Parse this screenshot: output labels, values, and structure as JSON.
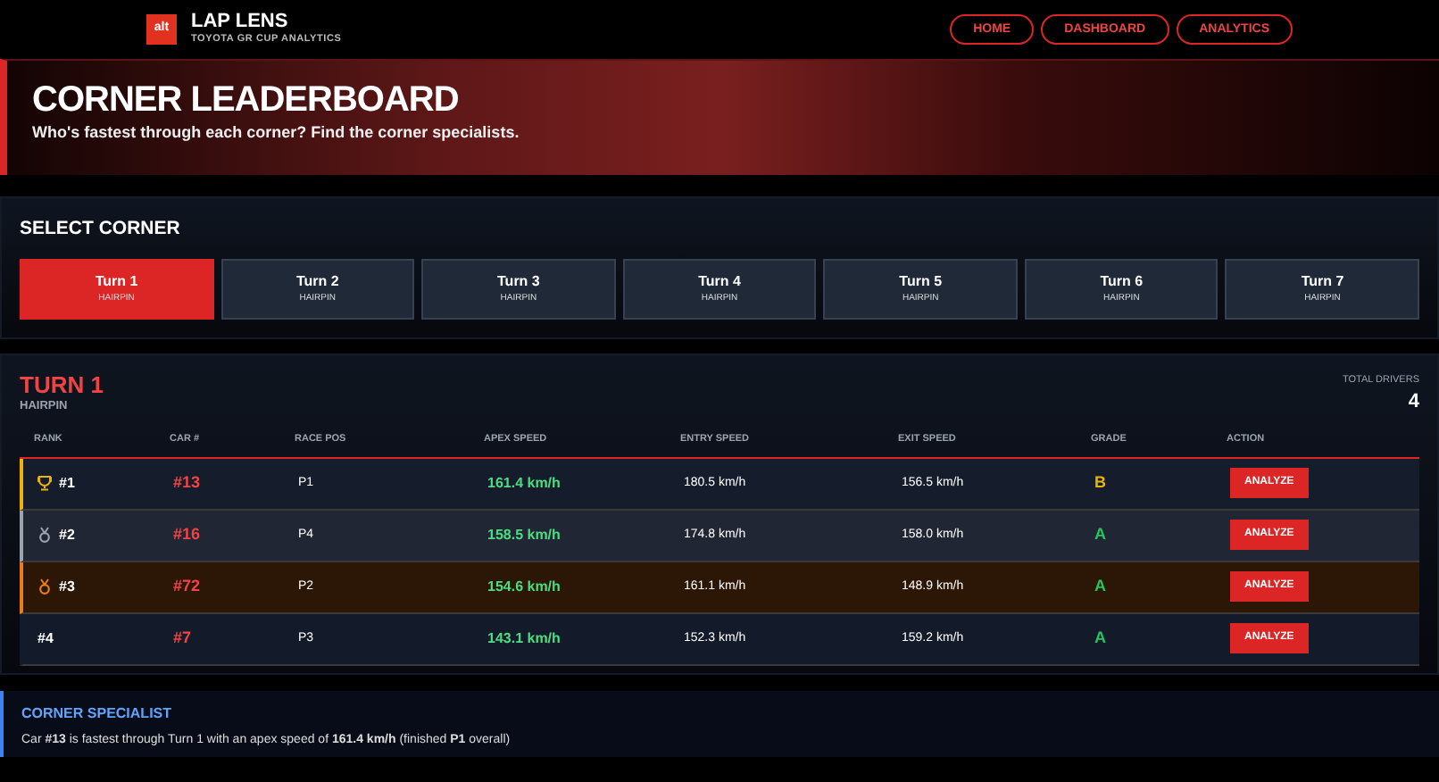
{
  "brand": {
    "logo": "alt",
    "title": "LAP LENS",
    "subtitle": "TOYOTA GR CUP ANALYTICS"
  },
  "nav": [
    {
      "label": "HOME"
    },
    {
      "label": "DASHBOARD"
    },
    {
      "label": "ANALYTICS"
    }
  ],
  "hero": {
    "title": "CORNER LEADERBOARD",
    "subtitle": "Who's fastest through each corner? Find the corner specialists."
  },
  "corner_picker": {
    "title": "SELECT CORNER",
    "corners": [
      {
        "label": "Turn 1",
        "type": "HAIRPIN",
        "selected": true
      },
      {
        "label": "Turn 2",
        "type": "HAIRPIN",
        "selected": false
      },
      {
        "label": "Turn 3",
        "type": "HAIRPIN",
        "selected": false
      },
      {
        "label": "Turn 4",
        "type": "HAIRPIN",
        "selected": false
      },
      {
        "label": "Turn 5",
        "type": "HAIRPIN",
        "selected": false
      },
      {
        "label": "Turn 6",
        "type": "HAIRPIN",
        "selected": false
      },
      {
        "label": "Turn 7",
        "type": "HAIRPIN",
        "selected": false
      }
    ]
  },
  "leaderboard": {
    "title": "TURN 1",
    "subtitle": "HAIRPIN",
    "total_label": "TOTAL DRIVERS",
    "total": "4",
    "columns": [
      "RANK",
      "CAR #",
      "RACE POS",
      "APEX SPEED",
      "ENTRY SPEED",
      "EXIT SPEED",
      "GRADE",
      "ACTION"
    ],
    "rows": [
      {
        "kind": "gold",
        "rank": "#1",
        "car": "#13",
        "race_pos": "P1",
        "apex": "161.4 km/h",
        "entry": "180.5 km/h",
        "exit": "156.5 km/h",
        "grade": "B",
        "color": "#eab308",
        "action": "ANALYZE"
      },
      {
        "kind": "silver",
        "rank": "#2",
        "car": "#16",
        "race_pos": "P4",
        "apex": "158.5 km/h",
        "entry": "174.8 km/h",
        "exit": "158.0 km/h",
        "grade": "A",
        "color": "#22c55e",
        "action": "ANALYZE"
      },
      {
        "kind": "bronze",
        "rank": "#3",
        "car": "#72",
        "race_pos": "P2",
        "apex": "154.6 km/h",
        "entry": "161.1 km/h",
        "exit": "148.9 km/h",
        "grade": "A",
        "color": "#22c55e",
        "action": "ANALYZE"
      },
      {
        "kind": "plain",
        "rank": "#4",
        "car": "#7",
        "race_pos": "P3",
        "apex": "143.1 km/h",
        "entry": "152.3 km/h",
        "exit": "159.2 km/h",
        "grade": "A",
        "color": "#22c55e",
        "action": "ANALYZE"
      }
    ]
  },
  "specialist": {
    "title": "CORNER SPECIALIST",
    "text": "Car **#13** is fastest through Turn 1 with an apex speed of **161.4 km/h** (finished **P1** overall)"
  }
}
